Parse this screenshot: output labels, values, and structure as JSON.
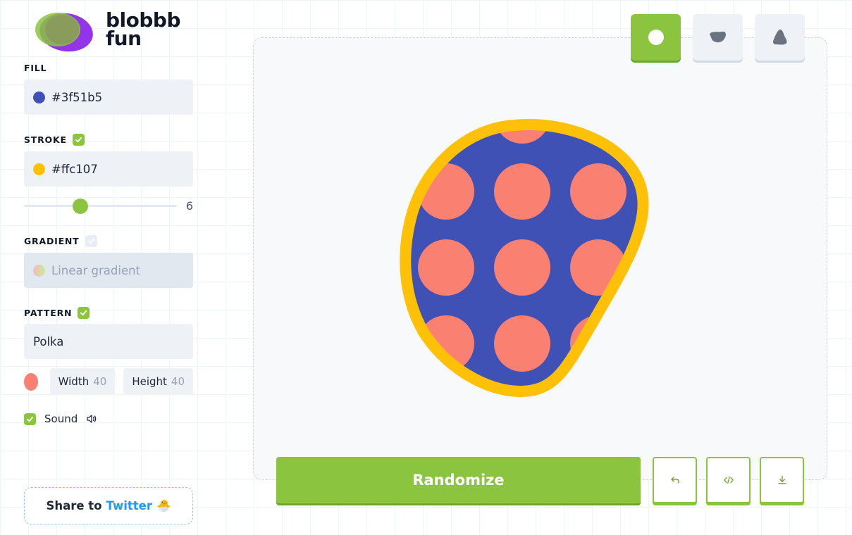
{
  "logo": {
    "line1": "blobbb",
    "line2": "fun"
  },
  "fill": {
    "label": "FILL",
    "value": "#3f51b5",
    "color": "#3f51b5"
  },
  "stroke": {
    "label": "STROKE",
    "enabled": true,
    "value": "#ffc107",
    "color": "#ffc107",
    "width": "6"
  },
  "gradient": {
    "label": "GRADIENT",
    "enabled": false,
    "placeholder": "Linear gradient"
  },
  "pattern": {
    "label": "PATTERN",
    "enabled": true,
    "value": "Polka",
    "color": "#fa8072",
    "width_label": "Width",
    "width_value": "40",
    "height_label": "Height",
    "height_value": "40"
  },
  "sound": {
    "label": "Sound",
    "enabled": true
  },
  "share": {
    "prefix": "Share to",
    "link": "Twitter",
    "emoji": "🐣"
  },
  "shapes": [
    {
      "name": "circle",
      "active": true
    },
    {
      "name": "blob",
      "active": false
    },
    {
      "name": "organic",
      "active": false
    }
  ],
  "actions": {
    "randomize": "Randomize"
  },
  "colors": {
    "accent": "#8bc53f",
    "twitter": "#1d9bf0"
  }
}
